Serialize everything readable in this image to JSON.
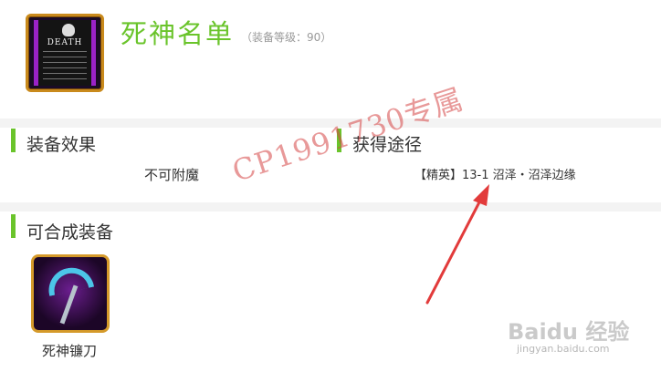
{
  "item": {
    "title": "死神名单",
    "level": "（装备等级：90）",
    "icon": "death-note-icon"
  },
  "sections": {
    "effect": {
      "title": "装备效果",
      "text": "不可附魔"
    },
    "source": {
      "title": "获得途径",
      "text": "【精英】13-1 沼泽・沼泽边缘"
    },
    "craft": {
      "title": "可合成装备",
      "items": [
        {
          "name": "死神镰刀",
          "icon": "scythe-icon"
        }
      ]
    }
  },
  "overlay": {
    "watermark": "CP1991730专属",
    "baidu_logo": "Baidu 经验",
    "baidu_url": "jingyan.baidu.com"
  },
  "colors": {
    "accent": "#6ac42b",
    "watermark": "#d64646",
    "arrow": "#e23b3b"
  }
}
